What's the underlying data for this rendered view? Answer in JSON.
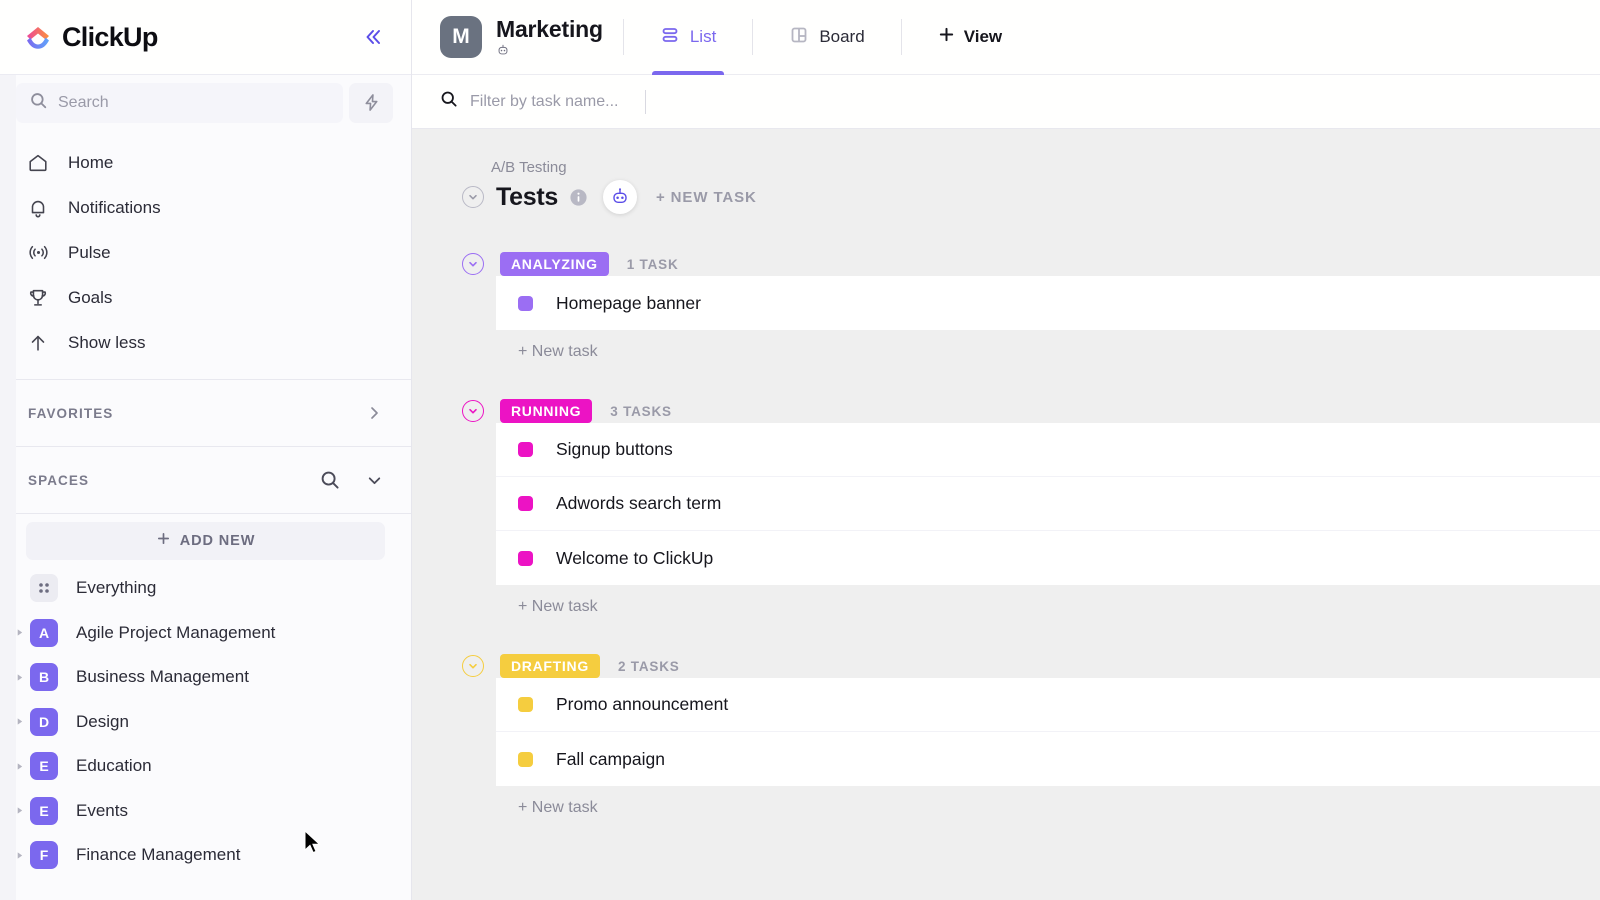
{
  "sidebar": {
    "brand": "ClickUp",
    "collapse_icon": "double-chevron-left-icon",
    "search": {
      "placeholder": "Search",
      "icon": "search-icon",
      "action_icon": "lightning-bolt-icon"
    },
    "nav": [
      {
        "label": "Home",
        "icon": "home-icon"
      },
      {
        "label": "Notifications",
        "icon": "bell-icon"
      },
      {
        "label": "Pulse",
        "icon": "pulse-icon"
      },
      {
        "label": "Goals",
        "icon": "trophy-icon"
      },
      {
        "label": "Show less",
        "icon": "arrow-up-icon"
      }
    ],
    "favorites": {
      "title": "FAVORITES",
      "expand_icon": "chevron-right-icon"
    },
    "spaces": {
      "title": "SPACES",
      "search_icon": "search-icon",
      "collapse_icon": "chevron-down-icon"
    },
    "add_new": {
      "label": "ADD NEW",
      "icon": "plus-icon"
    },
    "space_items": [
      {
        "label": "Everything",
        "initial": "",
        "icon": "grid-dots-icon",
        "neutral": true,
        "caret": false
      },
      {
        "label": "Agile Project Management",
        "initial": "A",
        "neutral": false,
        "caret": true
      },
      {
        "label": "Business Management",
        "initial": "B",
        "neutral": false,
        "caret": true
      },
      {
        "label": "Design",
        "initial": "D",
        "neutral": false,
        "caret": true
      },
      {
        "label": "Education",
        "initial": "E",
        "neutral": false,
        "caret": true
      },
      {
        "label": "Events",
        "initial": "E",
        "neutral": false,
        "caret": true
      },
      {
        "label": "Finance Management",
        "initial": "F",
        "neutral": false,
        "caret": true
      }
    ],
    "accent": "#7b68ee"
  },
  "topbar": {
    "list_initial": "M",
    "list_name": "Marketing",
    "ai_icon": "robot-icon",
    "tabs": [
      {
        "label": "List",
        "icon": "list-view-icon",
        "active": true
      },
      {
        "label": "Board",
        "icon": "board-view-icon",
        "active": false
      }
    ],
    "add_view": {
      "label": "View",
      "icon": "plus-icon"
    }
  },
  "filterbar": {
    "placeholder": "Filter by task name...",
    "icon": "search-icon"
  },
  "list": {
    "breadcrumb": "A/B Testing",
    "title": "Tests",
    "info_icon": "info-icon",
    "ai_icon": "robot-icon",
    "new_task_label": "+ NEW TASK",
    "collapse_icon": "chevron-down-icon"
  },
  "groups": [
    {
      "status": "ANALYZING",
      "color": "#9b6ef3",
      "count_label": "1 TASK",
      "new_task_label": "+ New task",
      "tasks": [
        {
          "name": "Homepage banner"
        }
      ]
    },
    {
      "status": "RUNNING",
      "color": "#ec13c4",
      "count_label": "3 TASKS",
      "new_task_label": "+ New task",
      "tasks": [
        {
          "name": "Signup buttons"
        },
        {
          "name": "Adwords search term"
        },
        {
          "name": "Welcome to ClickUp"
        }
      ]
    },
    {
      "status": "DRAFTING",
      "color": "#f5cd3f",
      "count_label": "2 TASKS",
      "new_task_label": "+ New task",
      "tasks": [
        {
          "name": "Promo announcement"
        },
        {
          "name": "Fall campaign"
        }
      ]
    }
  ]
}
